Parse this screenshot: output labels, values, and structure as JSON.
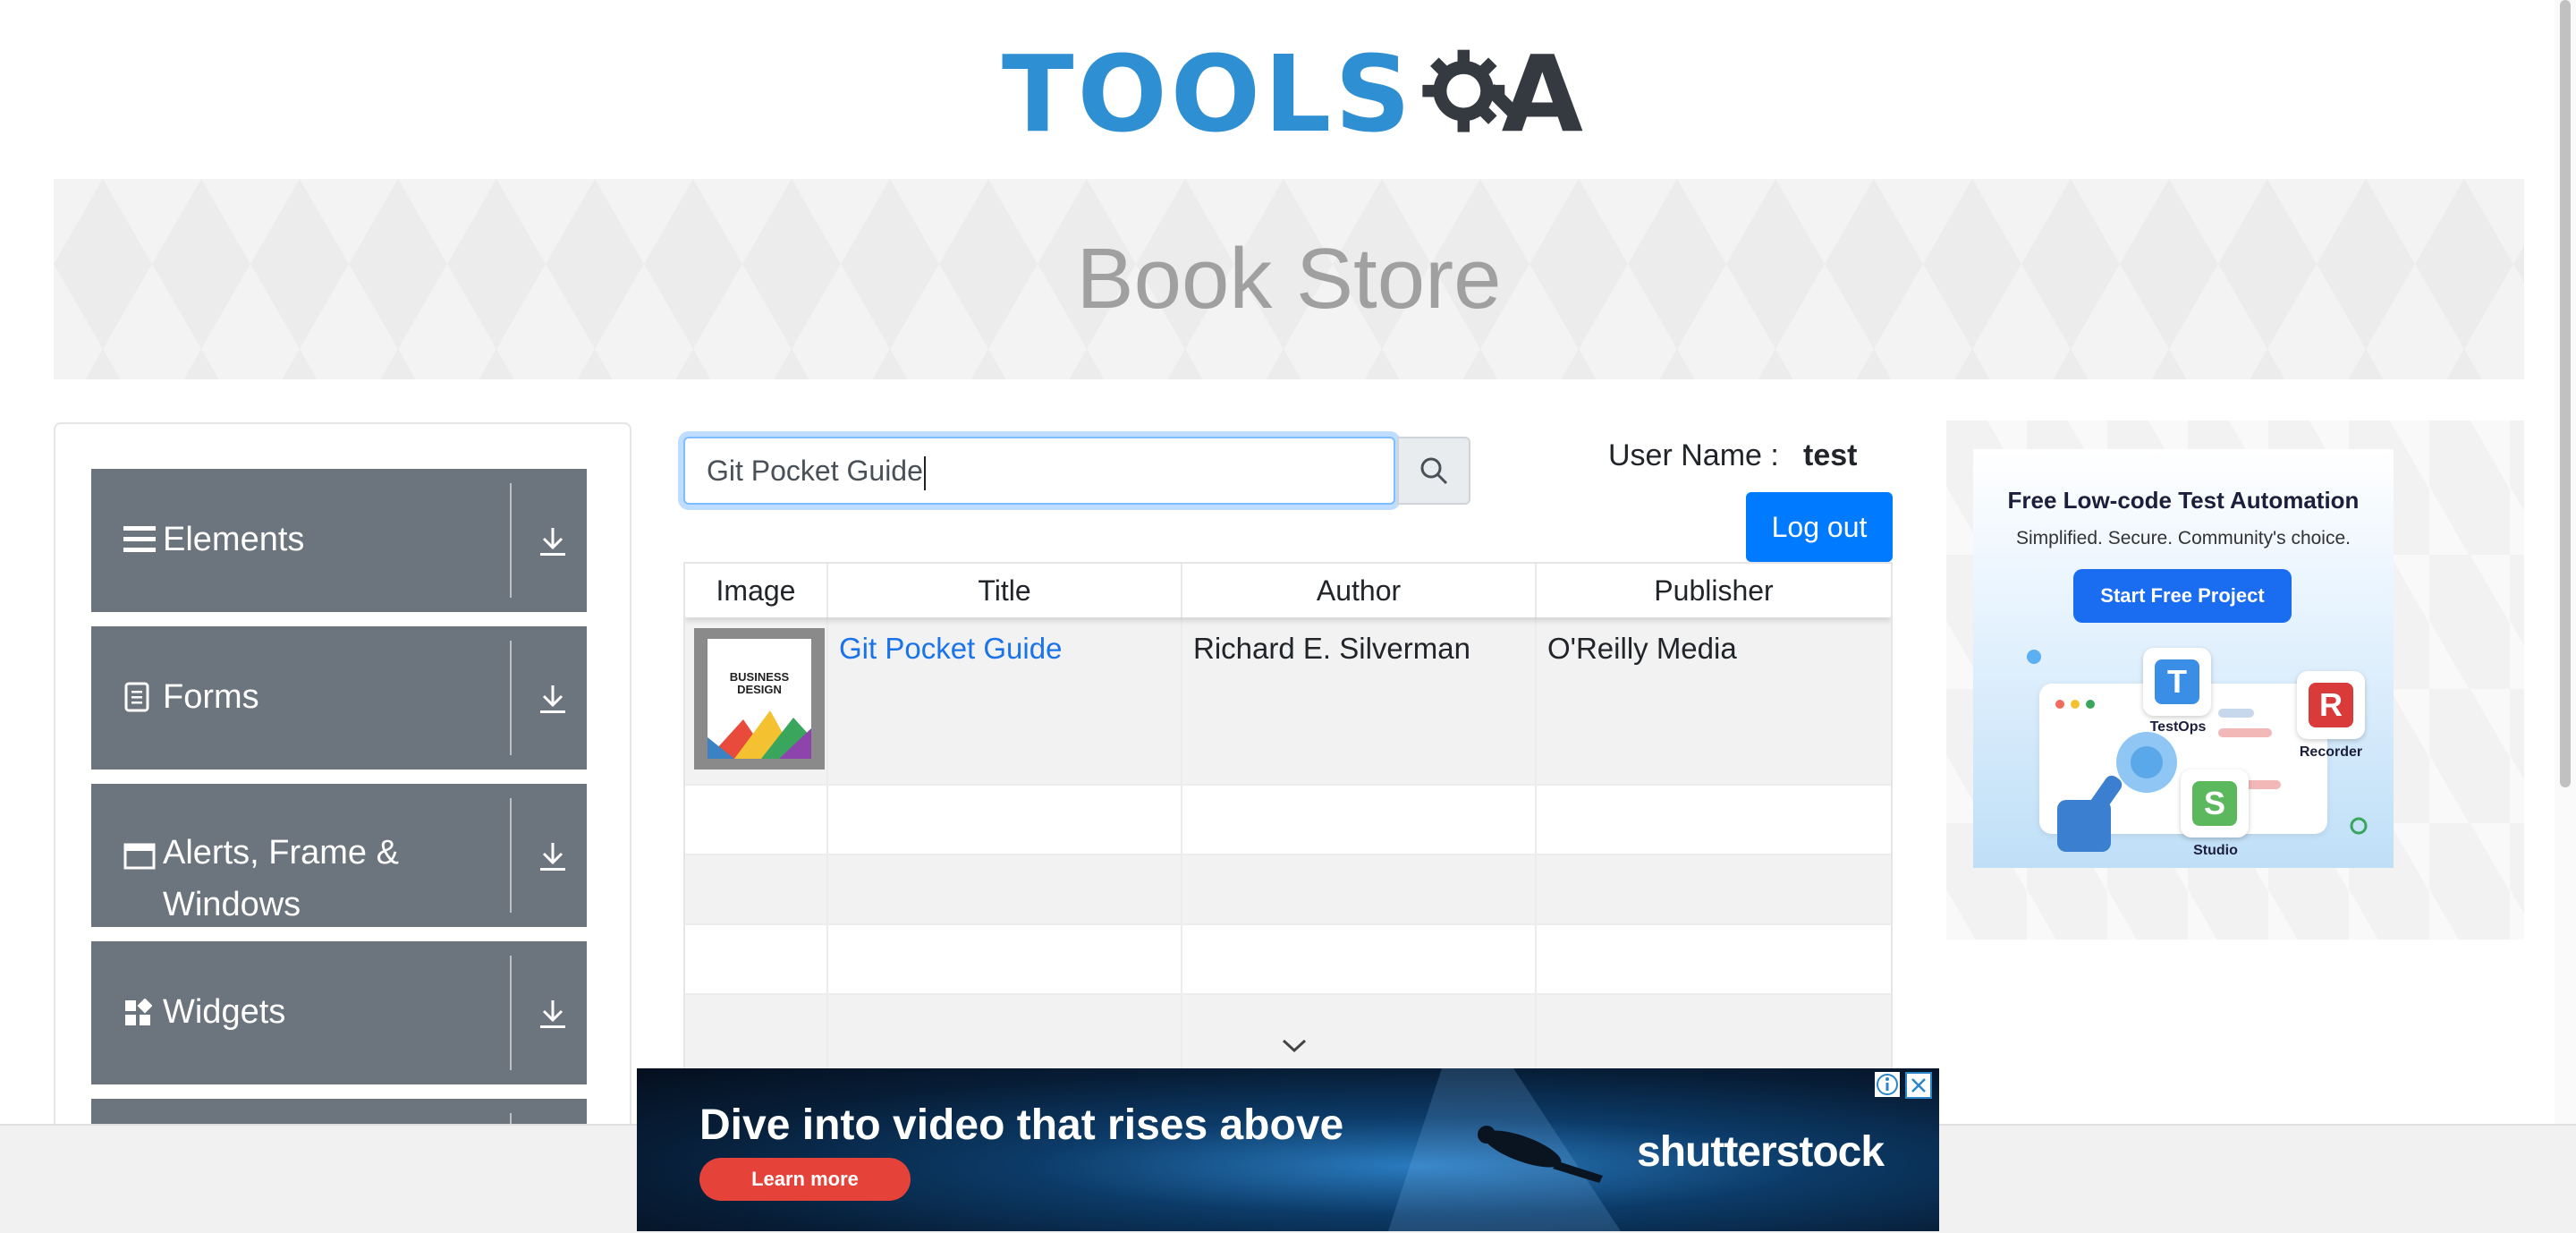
{
  "header": {
    "logo_text": "TOOLS",
    "logo_suffix": "A",
    "banner_title": "Book Store"
  },
  "sidebar": {
    "groups": [
      {
        "label": "Elements",
        "icon": "hamburger-icon"
      },
      {
        "label": "Forms",
        "icon": "document-icon"
      },
      {
        "label": "Alerts, Frame & Windows",
        "icon": "window-icon"
      },
      {
        "label": "Widgets",
        "icon": "widgets-icon"
      }
    ]
  },
  "search": {
    "value": "Git Pocket Guide",
    "placeholder": "Type to search"
  },
  "user": {
    "label": "User Name :",
    "value": "test",
    "logout_label": "Log out"
  },
  "table": {
    "columns": [
      "Image",
      "Title",
      "Author",
      "Publisher"
    ],
    "rows": [
      {
        "image_text": "BUSINESS DESIGN",
        "title": "Git Pocket Guide",
        "author": "Richard E. Silverman",
        "publisher": "O'Reilly Media"
      }
    ]
  },
  "ad_right": {
    "title": "Free Low-code Test Automation",
    "subtitle": "Simplified. Secure. Community's choice.",
    "cta": "Start Free Project",
    "tiles": [
      {
        "label": "TestOps",
        "glyph": "T"
      },
      {
        "label": "Recorder",
        "glyph": "R"
      },
      {
        "label": "Studio",
        "glyph": "S"
      }
    ]
  },
  "ad_bottom": {
    "headline": "Dive into video that rises above",
    "cta": "Learn more",
    "brand": "shutterstock"
  },
  "colors": {
    "primary": "#007bff",
    "sidebar": "#6c757d",
    "link": "#1a73e8",
    "logo_blue": "#2f8fd3"
  }
}
